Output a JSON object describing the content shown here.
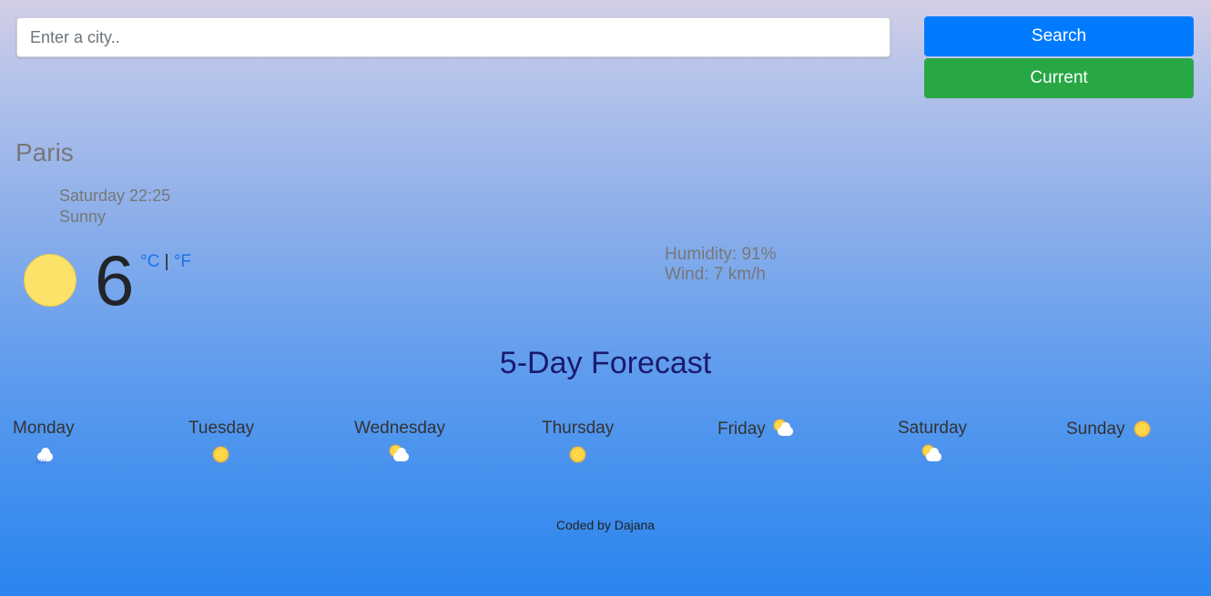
{
  "search": {
    "placeholder": "Enter a city..",
    "value": ""
  },
  "buttons": {
    "search_label": "Search",
    "current_label": "Current"
  },
  "current": {
    "city": "Paris",
    "datetime": "Saturday 22:25",
    "description": "Sunny",
    "temperature": "6",
    "unit_c": "°C",
    "unit_sep": "|",
    "unit_f": "°F",
    "humidity": "Humidity: 91%",
    "wind": "Wind: 7 km/h",
    "icon": "sun-icon"
  },
  "forecast": {
    "title": "5-Day Forecast",
    "days": [
      {
        "name": "Monday",
        "icon": "rain-cloud-icon"
      },
      {
        "name": "Tuesday",
        "icon": "sun-icon"
      },
      {
        "name": "Wednesday",
        "icon": "partly-cloudy-icon"
      },
      {
        "name": "Thursday",
        "icon": "sun-icon"
      },
      {
        "name": "Friday",
        "icon": "partly-cloudy-icon"
      },
      {
        "name": "Saturday",
        "icon": "partly-cloudy-icon"
      },
      {
        "name": "Sunday",
        "icon": "sun-icon"
      }
    ]
  },
  "footer": {
    "text": "Coded by Dajana"
  },
  "colors": {
    "search_button": "#007bff",
    "current_button": "#28a745",
    "title": "#1a1a6e",
    "link": "#1a73e8"
  }
}
